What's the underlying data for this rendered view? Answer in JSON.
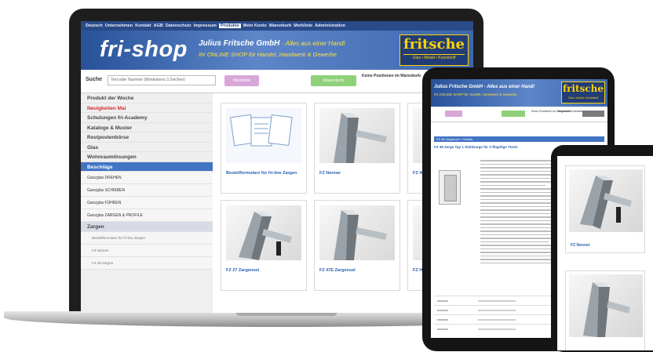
{
  "laptop": {
    "topnav": [
      "Deutsch",
      "Unternehmen",
      "Kontakt",
      "AGB",
      "Datenschutz",
      "Impressum",
      "Produkte",
      "Mein Konto",
      "Warenkorb",
      "Merkliste",
      "Administration"
    ],
    "topnav_active_index": 6,
    "logo": "fri-shop",
    "company": "Julius Fritsche GmbH",
    "company_tagline": "- Alles aus einer Hand!",
    "subtitle": "Ihr ONLINE SHOP für Handel, Handwerk & Gewerbe",
    "brand": "fritsche",
    "brand_sub": "Glas • Metall • Kunststoff",
    "search_label": "Suche",
    "search_placeholder": "Text oder Nummer (Mindestens 3 Zeichen)",
    "btn_pink": "Merkliste",
    "btn_green": "Warenkorb",
    "search_note": "Keine Positionen im Warenkorb",
    "sidebar": [
      {
        "label": "Produkt der Woche",
        "style": "normal"
      },
      {
        "label": "Neuigkeiten Mai",
        "style": "red"
      },
      {
        "label": "Schulungen fri-Academy",
        "style": "normal"
      },
      {
        "label": "Kataloge & Muster",
        "style": "normal"
      },
      {
        "label": "Restpostenbörse",
        "style": "normal"
      },
      {
        "label": "Glas",
        "style": "normal"
      },
      {
        "label": "Wohnraumlösungen",
        "style": "normal"
      },
      {
        "label": "Beschläge",
        "style": "active"
      },
      {
        "label": "Ganzglas DREHEN",
        "style": "sub"
      },
      {
        "label": "Ganzglas SCHIEBEN",
        "style": "sub"
      },
      {
        "label": "Ganzglas FÜHREN",
        "style": "sub"
      },
      {
        "label": "Ganzglas ZARGEN & PROFILE",
        "style": "sub"
      },
      {
        "label": "Zargen",
        "style": "sel"
      },
      {
        "label": "Bestellformulare für fri-line Zargen",
        "style": "subsub"
      },
      {
        "label": "FZ Nenner",
        "style": "subsub"
      },
      {
        "label": "FZ 48 Zargen",
        "style": "subsub"
      }
    ],
    "tiles": [
      {
        "caption": "Bestellformulare für fri-line Zargen",
        "kind": "forms"
      },
      {
        "caption": "FZ Nenner",
        "kind": "profile"
      },
      {
        "caption": "FZ 48 Z...",
        "kind": "profile"
      },
      {
        "caption": "FZ 27 Zargenset",
        "kind": "profile"
      },
      {
        "caption": "FZ 47E Zargenset",
        "kind": "profile"
      },
      {
        "caption": "FZ Hol...",
        "kind": "profile"
      }
    ]
  },
  "tablet": {
    "title": "Julius Fritsche GmbH - Alles aus einer Hand!",
    "subtitle": "Ihr ONLINE SHOP für Handel, Handwerk & Gewerbe",
    "brand": "fritsche",
    "brand_sub": "Glas • Metall • Kunststoff",
    "note1": "Keine Positionen im Warenkorb",
    "note2": "Angemeldet Abmelden",
    "bar": "FZ 48 Zargenset > Details",
    "heading": "FZ 48 Zarge Typ 1 Stahlzarge für 2-flügelige Türen"
  },
  "phone": {
    "tiles": [
      {
        "caption": "FZ Nenner"
      },
      {
        "caption": ""
      }
    ]
  }
}
